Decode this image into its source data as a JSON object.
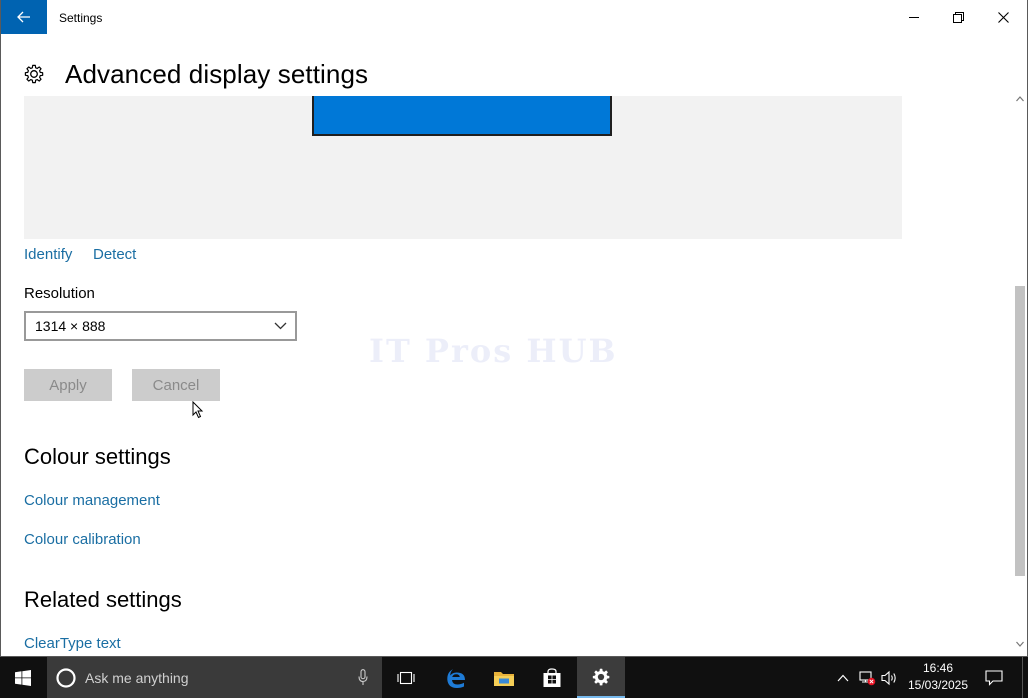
{
  "window": {
    "title": "Settings",
    "page_title": "Advanced display settings"
  },
  "display": {
    "identify_label": "Identify",
    "detect_label": "Detect",
    "resolution_label": "Resolution",
    "resolution_value": "1314 × 888",
    "apply_label": "Apply",
    "cancel_label": "Cancel",
    "monitor_color": "#0078d7"
  },
  "colour_section": {
    "heading": "Colour settings",
    "links": [
      "Colour management",
      "Colour calibration"
    ]
  },
  "related_section": {
    "heading": "Related settings",
    "links": [
      "ClearType text"
    ]
  },
  "watermark": "IT Pros HUB",
  "taskbar": {
    "search_placeholder": "Ask me anything",
    "time": "16:46",
    "date": "15/03/2025",
    "apps": [
      "task-view-icon",
      "edge-icon",
      "file-explorer-icon",
      "store-icon",
      "settings-icon"
    ],
    "active_app": "settings-icon"
  },
  "colors": {
    "accent": "#0063b1",
    "link": "#1a6ea3",
    "taskbar": "#101010"
  }
}
